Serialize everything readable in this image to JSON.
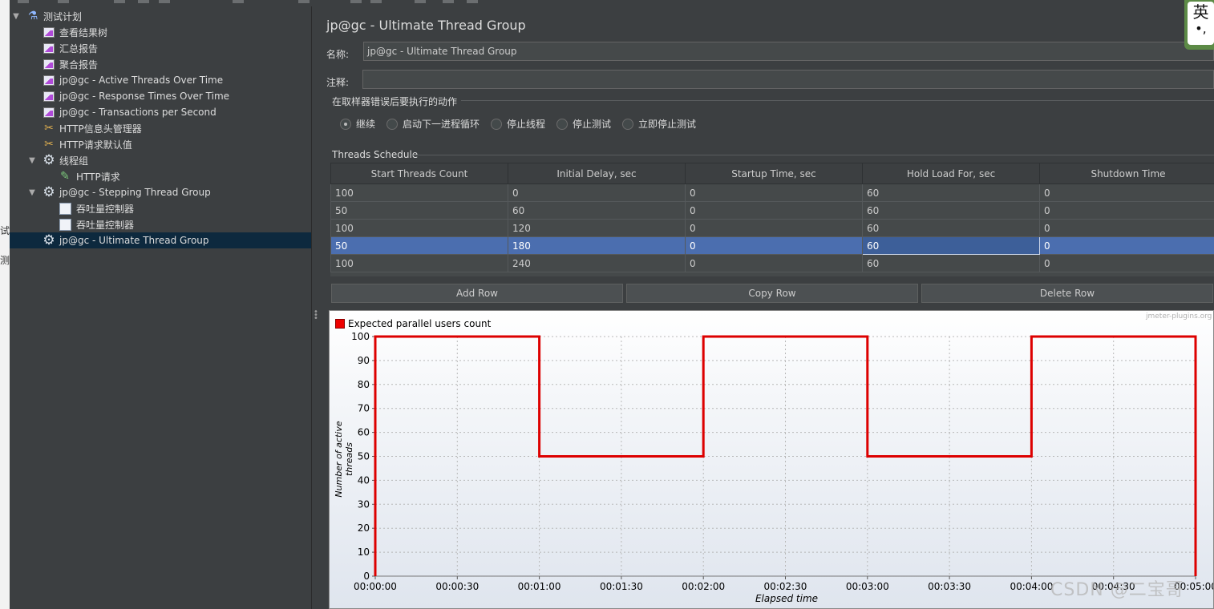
{
  "edge": {
    "chars": [
      "试",
      "测"
    ]
  },
  "tree": {
    "items": [
      {
        "label": "测试计划",
        "icon": "flask-icon",
        "arrow": "expanded"
      },
      {
        "label": "查看结果树",
        "icon": "chart-icon"
      },
      {
        "label": "汇总报告",
        "icon": "chart-icon"
      },
      {
        "label": "聚合报告",
        "icon": "chart-icon"
      },
      {
        "label": "jp@gc - Active Threads Over Time",
        "icon": "chart-icon"
      },
      {
        "label": "jp@gc - Response Times Over Time",
        "icon": "chart-icon"
      },
      {
        "label": "jp@gc - Transactions per Second",
        "icon": "chart-icon"
      },
      {
        "label": "HTTP信息头管理器",
        "icon": "wrench-icon"
      },
      {
        "label": "HTTP请求默认值",
        "icon": "wrench-icon"
      },
      {
        "label": "线程组",
        "icon": "gear-icon",
        "arrow": "expanded"
      },
      {
        "label": "HTTP请求",
        "icon": "pipette-icon"
      },
      {
        "label": "jp@gc - Stepping Thread Group",
        "icon": "gear-icon",
        "arrow": "expanded"
      },
      {
        "label": "吞吐量控制器",
        "icon": "controller-icon"
      },
      {
        "label": "吞吐量控制器",
        "icon": "controller-icon"
      },
      {
        "label": "jp@gc - Ultimate Thread Group",
        "icon": "gear-icon",
        "selected": true
      }
    ]
  },
  "panel": {
    "title": "jp@gc - Ultimate Thread Group",
    "name_label": "名称:",
    "name_value": "jp@gc - Ultimate Thread Group",
    "comment_label": "注释:",
    "comment_value": "",
    "error_section": "在取样器错误后要执行的动作",
    "error_options": [
      {
        "label": "继续",
        "checked": true
      },
      {
        "label": "启动下一进程循环",
        "checked": false
      },
      {
        "label": "停止线程",
        "checked": false
      },
      {
        "label": "停止测试",
        "checked": false
      },
      {
        "label": "立即停止测试",
        "checked": false
      }
    ],
    "schedule_section": "Threads Schedule",
    "columns": [
      "Start Threads Count",
      "Initial Delay, sec",
      "Startup Time, sec",
      "Hold Load For, sec",
      "Shutdown Time"
    ],
    "rows": [
      [
        "100",
        "0",
        "0",
        "60",
        "0"
      ],
      [
        "50",
        "60",
        "0",
        "60",
        "0"
      ],
      [
        "100",
        "120",
        "0",
        "60",
        "0"
      ],
      [
        "50",
        "180",
        "0",
        "60",
        "0"
      ],
      [
        "100",
        "240",
        "0",
        "60",
        "0"
      ]
    ],
    "selected_row": 3,
    "buttons": {
      "add": "Add Row",
      "copy": "Copy Row",
      "delete": "Delete Row"
    }
  },
  "chart_data": {
    "type": "line",
    "title": "",
    "watermark": "jmeter-plugins.org",
    "legend": "Expected parallel users count",
    "legend_position": "top-left",
    "xlabel": "Elapsed time",
    "ylabel": "Number of active threads",
    "ylim": [
      0,
      100
    ],
    "yticks": [
      "0",
      "10",
      "20",
      "30",
      "40",
      "50",
      "60",
      "70",
      "80",
      "90",
      "100"
    ],
    "xticks": [
      "00:00:00",
      "00:00:30",
      "00:01:00",
      "00:01:30",
      "00:02:00",
      "00:02:30",
      "00:03:00",
      "00:03:30",
      "00:04:00",
      "00:04:30",
      "00:05:00"
    ],
    "xlim_sec": [
      0,
      300
    ],
    "grid": true,
    "color": "#dd0000",
    "series": [
      {
        "name": "Expected parallel users count",
        "points": [
          [
            0,
            0
          ],
          [
            0,
            100
          ],
          [
            60,
            100
          ],
          [
            60,
            50
          ],
          [
            120,
            50
          ],
          [
            120,
            100
          ],
          [
            180,
            100
          ],
          [
            180,
            50
          ],
          [
            240,
            50
          ],
          [
            240,
            100
          ],
          [
            300,
            100
          ],
          [
            300,
            0
          ]
        ]
      }
    ]
  },
  "ime": {
    "label": "英",
    "sub": "•,"
  },
  "watermark": "CSDN @二宝哥"
}
